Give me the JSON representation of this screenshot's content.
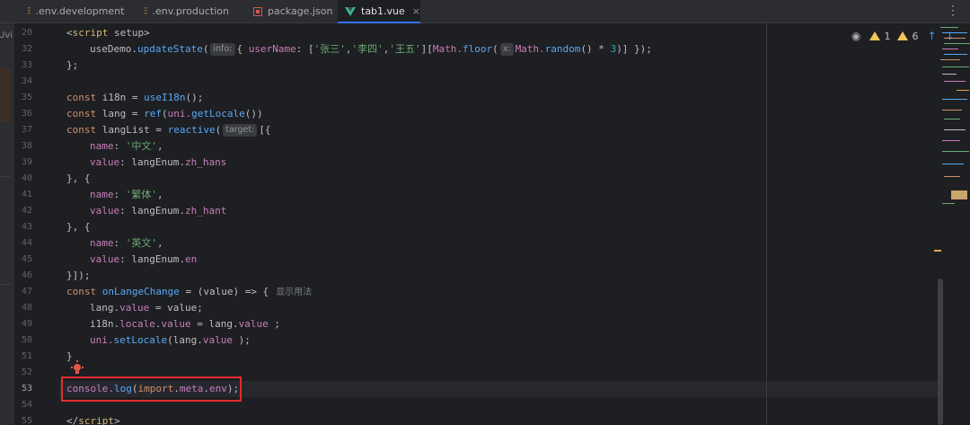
{
  "tabs": [
    {
      "label": ".env.development",
      "icon": "env-file-icon",
      "active": false
    },
    {
      "label": ".env.production",
      "icon": "env-file-icon",
      "active": false
    },
    {
      "label": "package.json",
      "icon": "json-file-icon",
      "active": false
    },
    {
      "label": "tab1.vue",
      "icon": "vue-file-icon",
      "active": true
    }
  ],
  "tab_close_glyph": "×",
  "left_panel_label": "Uvi",
  "inspections": {
    "warnings_a": "1",
    "warnings_b": "6"
  },
  "hints": {
    "info": "info:",
    "x": "x:",
    "target": "target:"
  },
  "inlay_comment": "显示用法",
  "lines": [
    {
      "n": "20"
    },
    {
      "n": "32"
    },
    {
      "n": "33"
    },
    {
      "n": "34"
    },
    {
      "n": "35"
    },
    {
      "n": "36"
    },
    {
      "n": "37"
    },
    {
      "n": "38"
    },
    {
      "n": "39"
    },
    {
      "n": "40"
    },
    {
      "n": "41"
    },
    {
      "n": "42"
    },
    {
      "n": "43"
    },
    {
      "n": "44"
    },
    {
      "n": "45"
    },
    {
      "n": "46"
    },
    {
      "n": "47"
    },
    {
      "n": "48"
    },
    {
      "n": "49"
    },
    {
      "n": "50"
    },
    {
      "n": "51"
    },
    {
      "n": "52"
    },
    {
      "n": "53"
    },
    {
      "n": "54"
    },
    {
      "n": "55"
    }
  ],
  "code": {
    "l20": {
      "open": "<",
      "tag": "script",
      "attr": " setup",
      "close": ">"
    },
    "l32": {
      "obj": "useDemo.",
      "fn": "updateState",
      "p1": "(",
      "p2": "{ ",
      "prop": "userName",
      "p3": ": [",
      "s1": "'张三'",
      "c1": ",",
      "s2": "'李四'",
      "c2": ",",
      "s3": "'王五'",
      "p4": "][",
      "mathA": "Math.",
      "floor": "floor",
      "p5": "(",
      "mathB": "Math.",
      "random": "random",
      "p6": "() * ",
      "n3": "3",
      "p7": ")] });"
    },
    "l33": "};",
    "l35": {
      "kw": "const",
      "rest": " i18n = ",
      "fn": "useI18n",
      "end": "();"
    },
    "l36": {
      "kw": "const",
      "rest": " lang = ",
      "fn": "ref",
      "p1": "(",
      "obj": "uni.",
      "fn2": "getLocale",
      "end": "())"
    },
    "l37": {
      "kw": "const",
      "rest": " langList = ",
      "fn": "reactive",
      "p1": "(",
      "end": "[{"
    },
    "l38": {
      "prop": "name",
      "p": ": ",
      "str": "'中文'",
      "end": ","
    },
    "l39": {
      "prop": "value",
      "p": ": ",
      "obj": "langEnum.",
      "prop2": "zh_hans"
    },
    "l40": "}, {",
    "l41": {
      "prop": "name",
      "p": ": ",
      "str": "'繁体'",
      "end": ","
    },
    "l42": {
      "prop": "value",
      "p": ": ",
      "obj": "langEnum.",
      "prop2": "zh_hant"
    },
    "l43": "}, {",
    "l44": {
      "prop": "name",
      "p": ": ",
      "str": "'英文'",
      "end": ","
    },
    "l45": {
      "prop": "value",
      "p": ": ",
      "obj": "langEnum.",
      "prop2": "en"
    },
    "l46": "}]);",
    "l47": {
      "kw": "const",
      "sp": " ",
      "fn": "onLangeChange",
      "rest": " = (value) => {"
    },
    "l48": {
      "obj": "lang.",
      "prop": "value",
      "rest": " = value;"
    },
    "l49": {
      "obj": "i18n.",
      "prop": "locale",
      "dot": ".",
      "prop2": "value",
      "mid": " = lang.",
      "prop3": "value",
      "end": " ;"
    },
    "l50": {
      "obj": "uni.",
      "fn": "setLocale",
      "p": "(lang.",
      "prop": "value",
      "end": " );"
    },
    "l51": "}",
    "l53": {
      "obj": "console.",
      "fn": "log",
      "p1": "(",
      "kw": "import",
      "dot": ".",
      "prop": "meta",
      "dot2": ".",
      "prop2": "env",
      "end": ");"
    },
    "l55": {
      "open": "</",
      "tag": "script",
      "close": ">"
    }
  }
}
